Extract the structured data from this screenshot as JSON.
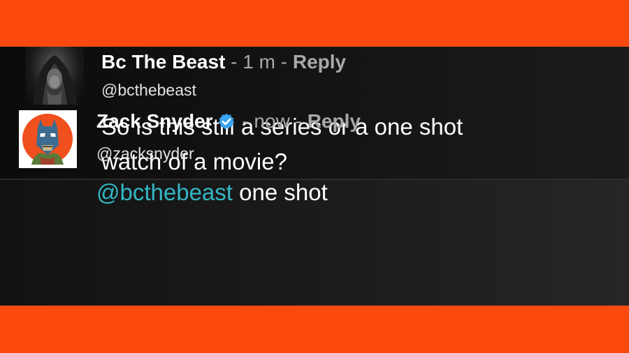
{
  "colors": {
    "frame": "#fc4a0e",
    "background": "#141414",
    "text": "#ffffff",
    "muted": "#a9a9a9",
    "mention": "#34b6c4",
    "verified": "#3aa3ef"
  },
  "comments": [
    {
      "author": "Bc The Beast",
      "time": "1 m",
      "reply": "Reply",
      "handle": "@bcthebeast",
      "body_lines": [
        "So is this still a series or a one shot",
        "watch of a movie?"
      ],
      "avatar_icon": "hooded-figure-avatar"
    },
    {
      "author": "Zack Snyder",
      "verified": true,
      "time": "now",
      "reply": "Reply",
      "handle": "@zacksnyder",
      "mention": "@bcthebeast",
      "body_text": "one shot",
      "avatar_icon": "batman-comic-avatar"
    }
  ]
}
